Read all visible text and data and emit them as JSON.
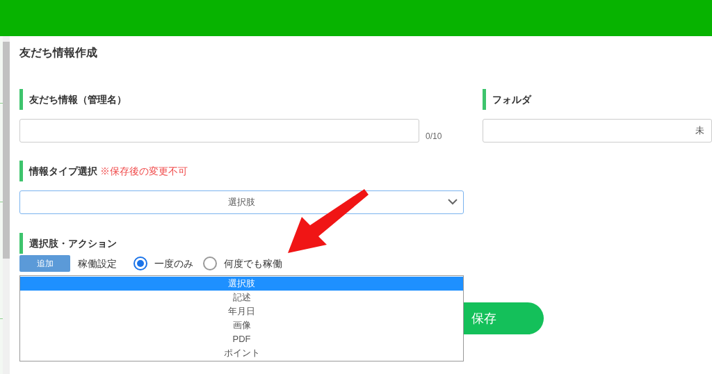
{
  "page_title": "友だち情報作成",
  "name_field": {
    "label": "友だち情報（管理名）",
    "counter": "0/10"
  },
  "folder_field": {
    "label": "フォルダ",
    "value": "未"
  },
  "info_type": {
    "label": "情報タイプ選択",
    "note": "※保存後の変更不可",
    "value": "選択肢",
    "options": [
      {
        "label": "選択肢",
        "selected": true
      },
      {
        "label": "記述",
        "selected": false
      },
      {
        "label": "年月日",
        "selected": false
      },
      {
        "label": "画像",
        "selected": false
      },
      {
        "label": "PDF",
        "selected": false
      },
      {
        "label": "ポイント",
        "selected": false
      }
    ]
  },
  "choices_section": {
    "label": "選択肢・アクション",
    "add_button": "追加",
    "operation_label": "稼働設定",
    "radios": [
      {
        "label": "一度のみ",
        "selected": true
      },
      {
        "label": "何度でも稼働",
        "selected": false
      }
    ]
  },
  "save_button": "保存"
}
